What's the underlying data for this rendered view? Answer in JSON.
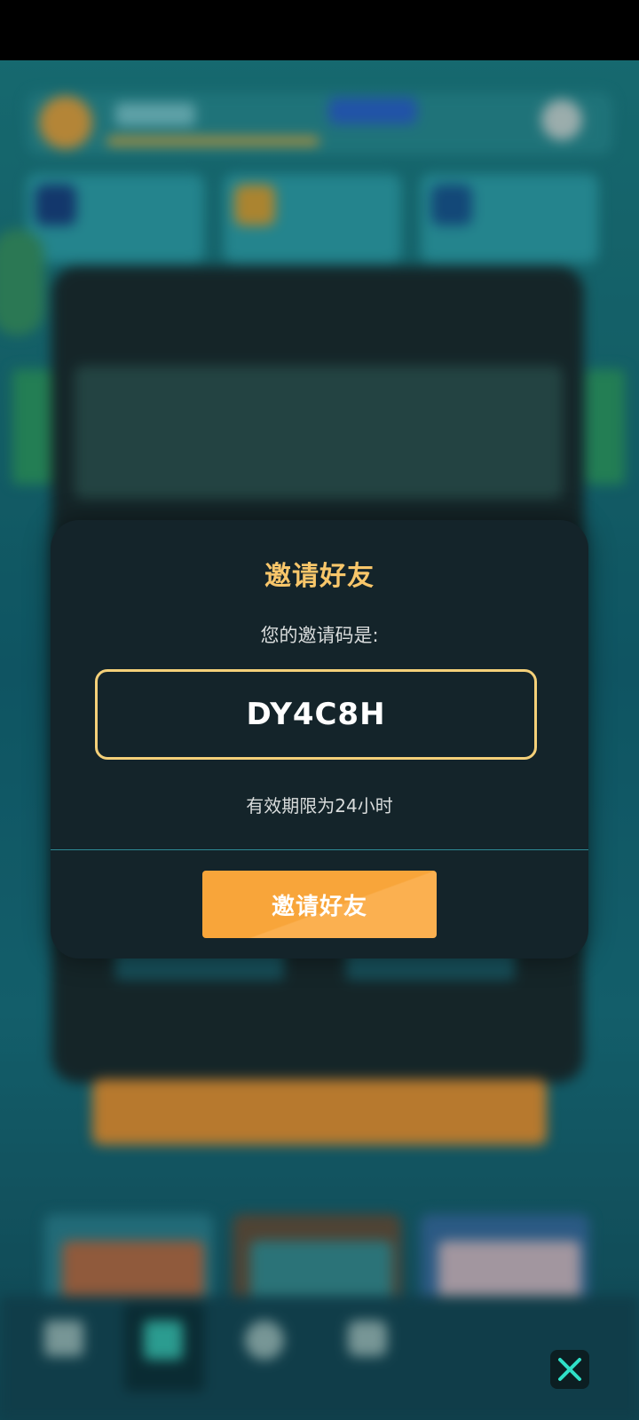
{
  "modal": {
    "title": "邀请好友",
    "code_label": "您的邀请码是:",
    "invite_code": "DY4C8H",
    "validity_text": "有效期限为24小时",
    "invite_button_label": "邀请好友"
  },
  "colors": {
    "accent_gold": "#f8c66a",
    "button_orange": "#f8a53a",
    "modal_bg": "#14242a",
    "close_icon_color": "#2fe0c8"
  },
  "icons": {
    "close": "close-icon"
  }
}
